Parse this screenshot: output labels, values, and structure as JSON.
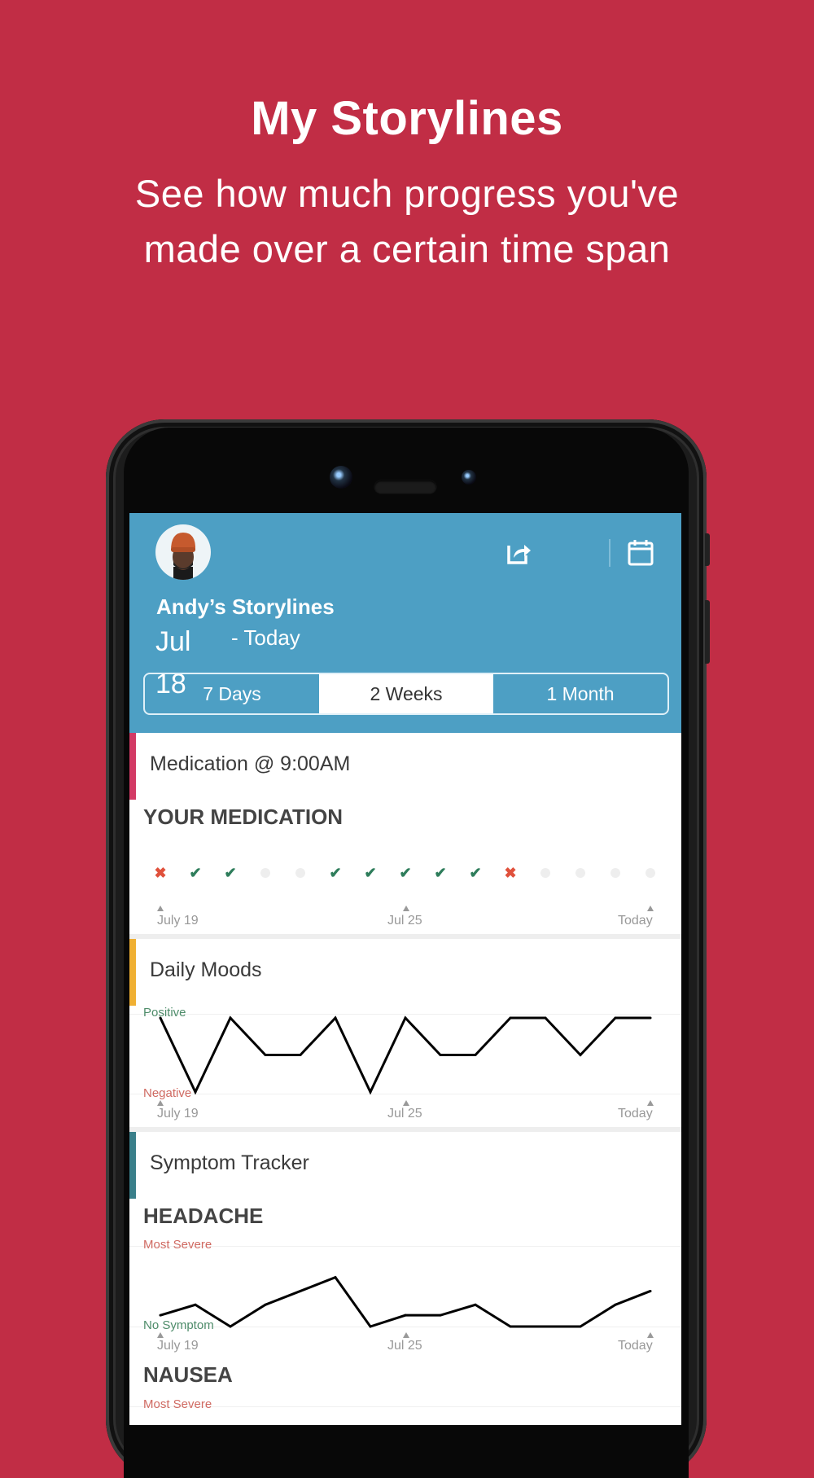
{
  "promo": {
    "headline": "My Storylines",
    "subline_1": "See how much progress you've",
    "subline_2": "made over a certain time span"
  },
  "header": {
    "avatar_alt": "Andy avatar",
    "title": "Andy’s Storylines",
    "date_start_month": "Jul",
    "date_start_day": "18",
    "date_end": "- Today",
    "share_icon": "share-icon",
    "calendar_icon": "calendar-icon",
    "segments": [
      {
        "label": "7 Days",
        "active": false
      },
      {
        "label": "2 Weeks",
        "active": true
      },
      {
        "label": "1 Month",
        "active": false
      }
    ]
  },
  "colors": {
    "background": "#c12d45",
    "header": "#4d9fc4",
    "medication_accent": "#d33a65",
    "moods_accent": "#f0b033",
    "symptom_accent": "#3a7f8a",
    "check": "#2e7d5b",
    "miss": "#e0513c",
    "positive": "#4e8c6a",
    "negative": "#d06a62"
  },
  "x_axis": {
    "start": "July 19",
    "mid": "Jul 25",
    "end": "Today"
  },
  "medication": {
    "card_title": "Medication @ 9:00AM",
    "section_title": "YOUR MEDICATION"
  },
  "moods": {
    "card_title": "Daily Moods",
    "y_top": "Positive",
    "y_bottom": "Negative"
  },
  "symptoms": {
    "card_title": "Symptom Tracker",
    "headache_title": "HEADACHE",
    "nausea_title": "NAUSEA",
    "y_top": "Most Severe",
    "y_bottom": "No Symptom"
  },
  "chart_data": [
    {
      "type": "table",
      "title": "YOUR MEDICATION",
      "x": [
        "July 19",
        "",
        "",
        "",
        "",
        "",
        "Jul 25",
        "",
        "",
        "",
        "",
        "",
        "",
        "",
        "Today"
      ],
      "values": [
        "missed",
        "taken",
        "taken",
        "none",
        "none",
        "taken",
        "taken",
        "taken",
        "taken",
        "taken",
        "missed",
        "none",
        "none",
        "none",
        "none"
      ]
    },
    {
      "type": "line",
      "title": "Daily Moods",
      "ylabel_top": "Positive",
      "ylabel_bottom": "Negative",
      "tick_labels": [
        "July 19",
        "Jul 25",
        "Today"
      ],
      "ylim": [
        0,
        1
      ],
      "values": [
        1,
        0,
        1,
        0.5,
        0.5,
        1,
        0,
        1,
        0.5,
        0.5,
        1,
        1,
        0.5,
        1,
        1
      ]
    },
    {
      "type": "line",
      "title": "HEADACHE",
      "ylabel_top": "Most Severe",
      "ylabel_bottom": "No Symptom",
      "tick_labels": [
        "July 19",
        "Jul 25",
        "Today"
      ],
      "ylim": [
        0,
        1
      ],
      "values": [
        0.14,
        0.27,
        0,
        0.27,
        0.44,
        0.61,
        0,
        0.14,
        0.14,
        0.27,
        0,
        0,
        0,
        0.27,
        0.44
      ]
    }
  ]
}
